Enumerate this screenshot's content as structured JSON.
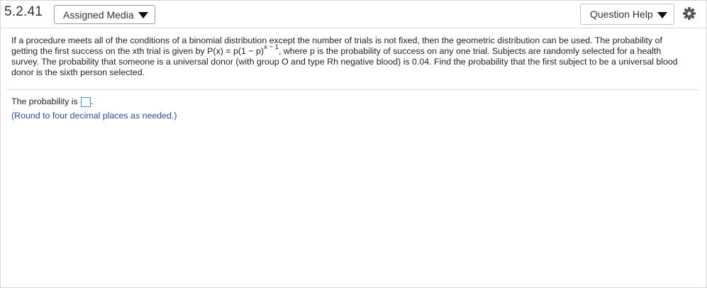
{
  "header": {
    "question_number": "5.2.41",
    "assigned_media_label": "Assigned Media",
    "question_help_label": "Question Help",
    "settings_icon": "gear-icon"
  },
  "question": {
    "text_part1": "If a procedure meets all of the conditions of a binomial distribution except the number of trials is not fixed, then the geometric distribution can be used. The probability of getting the first success on the xth trial is given by ",
    "formula": "P(x) = p(1 − p)",
    "exponent": "x − 1",
    "text_part2": ", where p is the probability of success on any one trial. Subjects are randomly selected for a health survey. The probability that someone is a universal donor (with group O and type Rh negative blood) is 0.04. Find the probability that the first subject to be a universal blood donor is the sixth person selected."
  },
  "answer": {
    "prefix": "The probability is",
    "suffix": ".",
    "value": "",
    "hint": "(Round to four decimal places as needed.)"
  }
}
